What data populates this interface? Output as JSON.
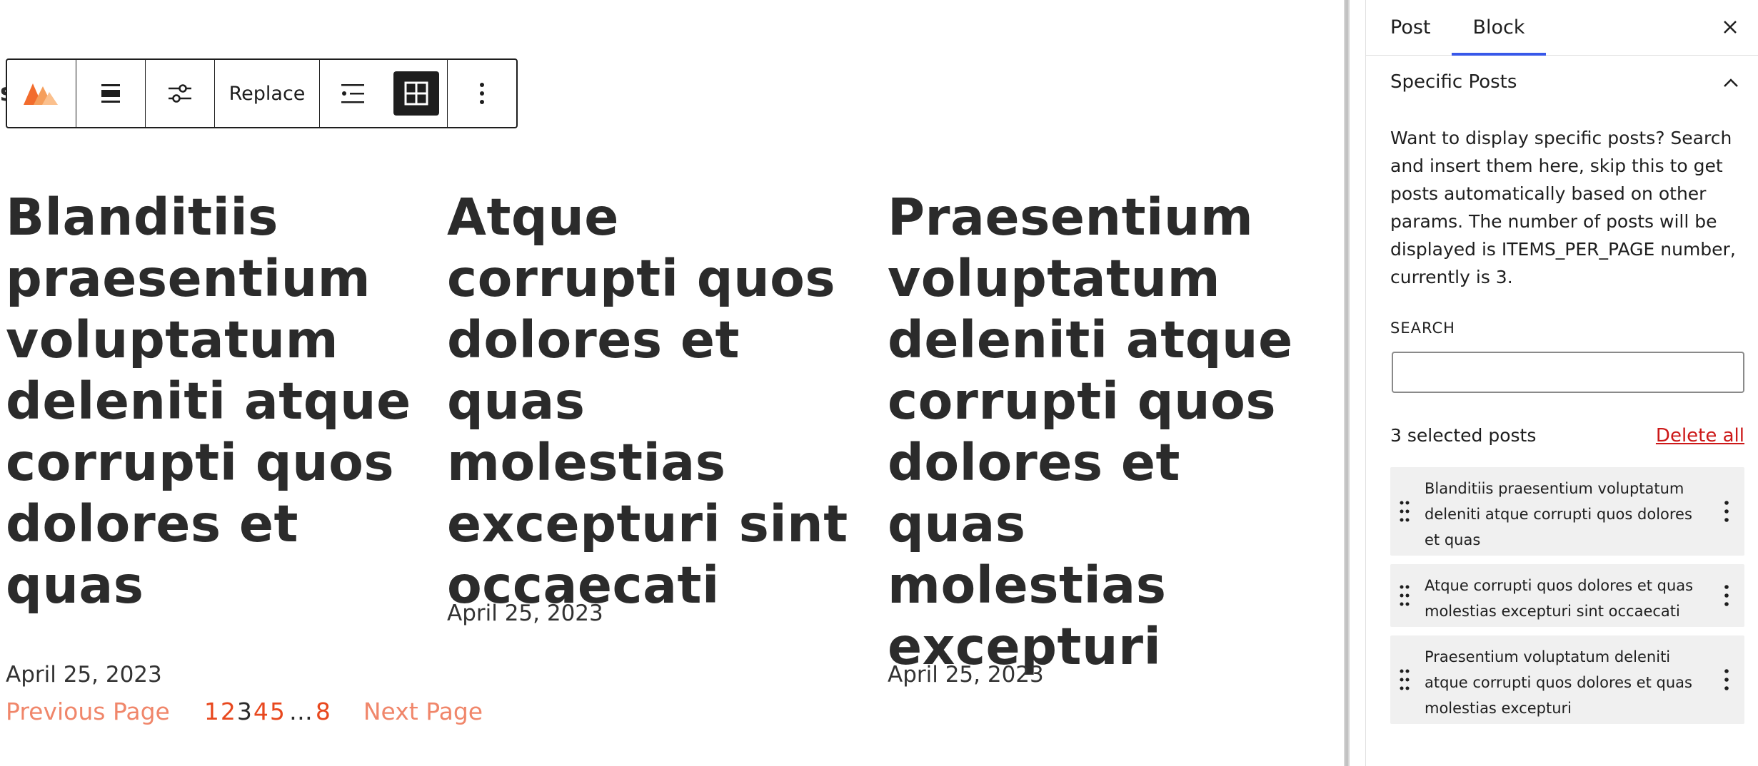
{
  "toolbar": {
    "replace_label": "Replace",
    "icons": [
      "block-type-icon",
      "align-icon",
      "settings-sliders-icon",
      "list-view-icon",
      "grid-view-icon",
      "more-options-icon"
    ]
  },
  "stub_letter": "s",
  "posts": [
    {
      "title": "Blanditiis praesentium voluptatum deleniti atque corrupti quos dolores et quas",
      "date": "April 25, 2023"
    },
    {
      "title": "Atque corrupti quos dolores et quas molestias excepturi sint occaecati",
      "date": "April 25, 2023"
    },
    {
      "title": "Praesentium voluptatum deleniti atque corrupti quos dolores et quas molestias excepturi",
      "date": "April 25, 2023"
    }
  ],
  "pagination": {
    "previous": "Previous Page",
    "pages": [
      "1",
      "2",
      "3",
      "4",
      "5"
    ],
    "current": "3",
    "dots": "…",
    "last": "8",
    "next": "Next Page"
  },
  "sidebar": {
    "tabs": [
      "Post",
      "Block"
    ],
    "active_tab": "Block",
    "section_title": "Specific Posts",
    "description": "Want to display specific posts? Search and insert them here, skip this to get posts automatically based on other params. The number of posts will be displayed is ITEMS_PER_PAGE number, currently is 3.",
    "search_label": "SEARCH",
    "search_value": "",
    "selected_count": "3 selected posts",
    "delete_all": "Delete all",
    "selected_items": [
      "Blanditiis praesentium voluptatum deleniti atque corrupti quos dolores et quas",
      "Atque corrupti quos dolores et quas molestias excepturi sint occaecati",
      "Praesentium voluptatum deleniti atque corrupti quos dolores et quas molestias excepturi"
    ]
  },
  "colors": {
    "accent": "#3858e9",
    "pagination_link": "#f0866a",
    "pagination_number": "#e8481e",
    "delete": "#cc1818",
    "text": "#2b2b2b"
  }
}
